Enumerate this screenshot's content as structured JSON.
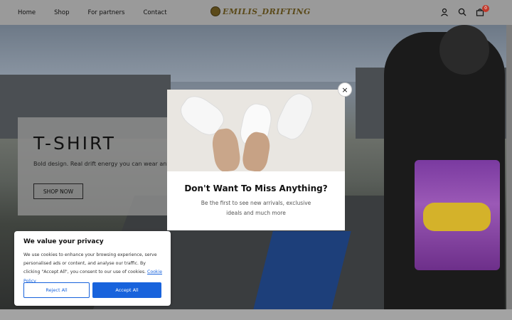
{
  "header": {
    "nav": [
      "Home",
      "Shop",
      "For partners",
      "Contact"
    ],
    "logo_text": "EMILIS_DRIFTING",
    "cart_count": "0",
    "icons": [
      "account-icon",
      "search-icon",
      "cart-icon"
    ]
  },
  "hero": {
    "title": "T-SHIRT",
    "subtitle": "Bold design. Real drift energy you can wear anyw",
    "button": "SHOP NOW",
    "slides": 4,
    "active_slide": 1
  },
  "popup": {
    "title": "Don't Want To Miss Anything?",
    "text": "Be the first to see new arrivals, exclusive ideals and much more",
    "close": "×"
  },
  "cookie": {
    "title": "We value your privacy",
    "text": "We use cookies to enhance your browsing experience, serve personalised ads or content, and analyse our traffic. By clicking \"Accept All\", you consent to our use of cookies.",
    "link": "Cookie Policy",
    "reject": "Reject All",
    "accept": "Accept All"
  },
  "colors": {
    "accent": "#1863dc",
    "badge": "#c0392b"
  }
}
